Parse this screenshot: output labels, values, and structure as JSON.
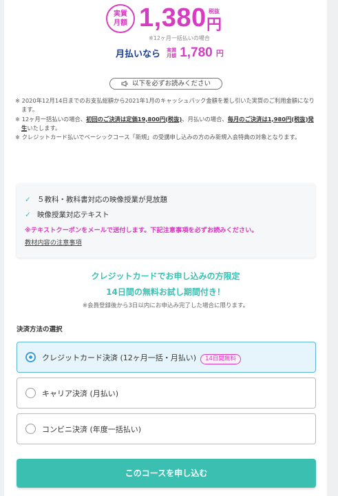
{
  "price": {
    "badge_line1": "実質",
    "badge_line2": "月額",
    "amount": "1,380",
    "yen": "円",
    "tax_note": "税抜",
    "sub_note": "※12ヶ月一括払いの場合",
    "monthly_label": "月払いなら",
    "monthly_badge_line1": "実質",
    "monthly_badge_line2": "月額",
    "monthly_amount": "1,780",
    "monthly_yen": "円"
  },
  "must_read": {
    "label": "以下を必ずお読みください"
  },
  "notes": {
    "n1": "※ 2020年12月14日までのお支払総額から2021年1月のキャッシュバック金額を差し引いた実質のご利用金額になります。",
    "n2_a": "※ 12ヶ月一括払いの場合、",
    "n2_b": "初回のご決済は定価19,800円(税抜)",
    "n2_c": "、月払いの場合、",
    "n2_d": "毎月のご決済は1,980円(税抜)発生",
    "n2_e": "いたします。",
    "n3": "※ クレジットカード払いでベーシックコース「新規」の受講申し込みの方のみ新規入会特典の対象となります。"
  },
  "features": {
    "item1": "５教科・教科書対応の映像授業が見放題",
    "item2": "映像授業対応テキスト",
    "warning": "※テキストクーポンをメールで送付します。下記注意事項を必ずお読みください。",
    "link": "教材内容の注意事項"
  },
  "campaign": {
    "line1": "クレジットカードでお申し込みの方限定",
    "line2": "14日間の無料お試し期間付き！",
    "note": "※会員登録後から3日以内にお申込み完了した場合に限ります。"
  },
  "payment": {
    "title": "決済方法の選択",
    "options": [
      {
        "label": "クレジットカード決済 (12ヶ月一括・月払い)",
        "badge": "14日間無料",
        "selected": true
      },
      {
        "label": "キャリア決済 (月払い)",
        "selected": false
      },
      {
        "label": "コンビニ決済 (年度一括払い)",
        "selected": false
      }
    ]
  },
  "submit": {
    "label": "このコースを申し込む"
  },
  "colors": {
    "accent_pink": "#d63cc1",
    "accent_teal": "#3bbfb1",
    "navy": "#1c3d8f",
    "radio_blue": "#3a9bd5"
  },
  "icons": {
    "must_read": "megaphone-icon",
    "feature_check": "check-icon"
  }
}
